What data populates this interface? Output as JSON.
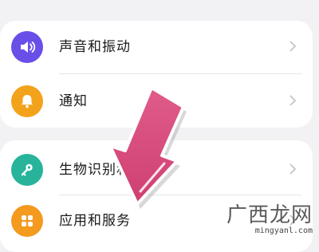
{
  "settings": {
    "items": [
      {
        "label": "声音和振动",
        "icon": "speaker-icon",
        "color": "#6a4ee8"
      },
      {
        "label": "通知",
        "icon": "bell-icon",
        "color": "#f3a21b"
      },
      {
        "label": "生物识别和密码",
        "icon": "key-icon",
        "color": "#27b49a"
      },
      {
        "label": "应用和服务",
        "icon": "apps-grid-icon",
        "color": "#f39a1f"
      }
    ]
  },
  "overlay": {
    "arrow_color": "#d94a7c"
  },
  "watermark": {
    "title": "广西龙网",
    "url": "mingyanl.com"
  }
}
